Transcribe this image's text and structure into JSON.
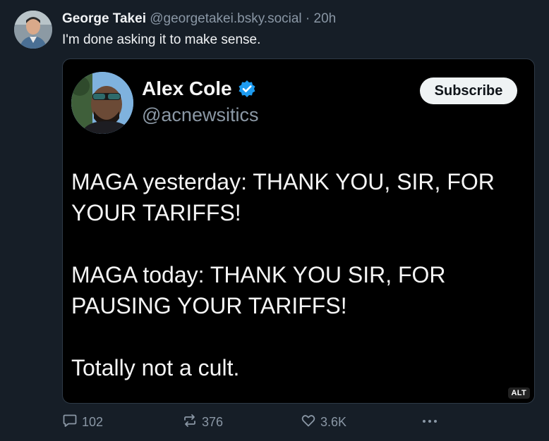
{
  "post": {
    "author_name": "George Takei",
    "handle": "@georgetakei.bsky.social",
    "separator": "·",
    "time": "20h",
    "text": "I'm done asking it to make sense."
  },
  "embed": {
    "name": "Alex Cole",
    "handle": "@acnewsitics",
    "subscribe_label": "Subscribe",
    "body": [
      "MAGA yesterday: THANK YOU, SIR, FOR YOUR TARIFFS!",
      "MAGA today: THANK YOU SIR, FOR PAUSING YOUR TARIFFS!",
      "Totally not a cult."
    ],
    "alt_label": "ALT"
  },
  "actions": {
    "replies": "102",
    "reposts": "376",
    "likes": "3.6K"
  },
  "colors": {
    "background": "#161e27",
    "verified": "#1d9bf0"
  },
  "icons": [
    "reply-icon",
    "repost-icon",
    "like-icon",
    "more-icon",
    "verified-badge-icon"
  ]
}
